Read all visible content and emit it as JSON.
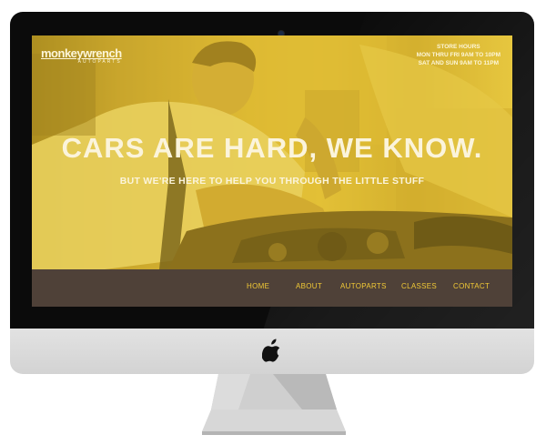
{
  "site": {
    "logo_main": "monkeywrench",
    "logo_sub": "AUTOPARTS",
    "store_hours": {
      "title": "STORE HOURS",
      "line1": "MON THRU FRI 9AM TO 10PM",
      "line2": "SAT AND SUN 9AM TO 11PM"
    },
    "headline": "CARS ARE HARD, WE KNOW.",
    "subheadline": "BUT WE'RE HERE TO HELP YOU THROUGH THE LITTLE STUFF",
    "nav": [
      {
        "label": "HOME"
      },
      {
        "label": "ABOUT"
      },
      {
        "label": "AUTOPARTS"
      },
      {
        "label": "CLASSES"
      },
      {
        "label": "CONTACT"
      }
    ]
  },
  "colors": {
    "hero_yellow": "#e2c12d",
    "nav_bg": "#4f4138",
    "nav_text": "#f1c936",
    "headline_text": "#fbf4dc"
  },
  "device": {
    "brand_icon": "apple-icon"
  }
}
